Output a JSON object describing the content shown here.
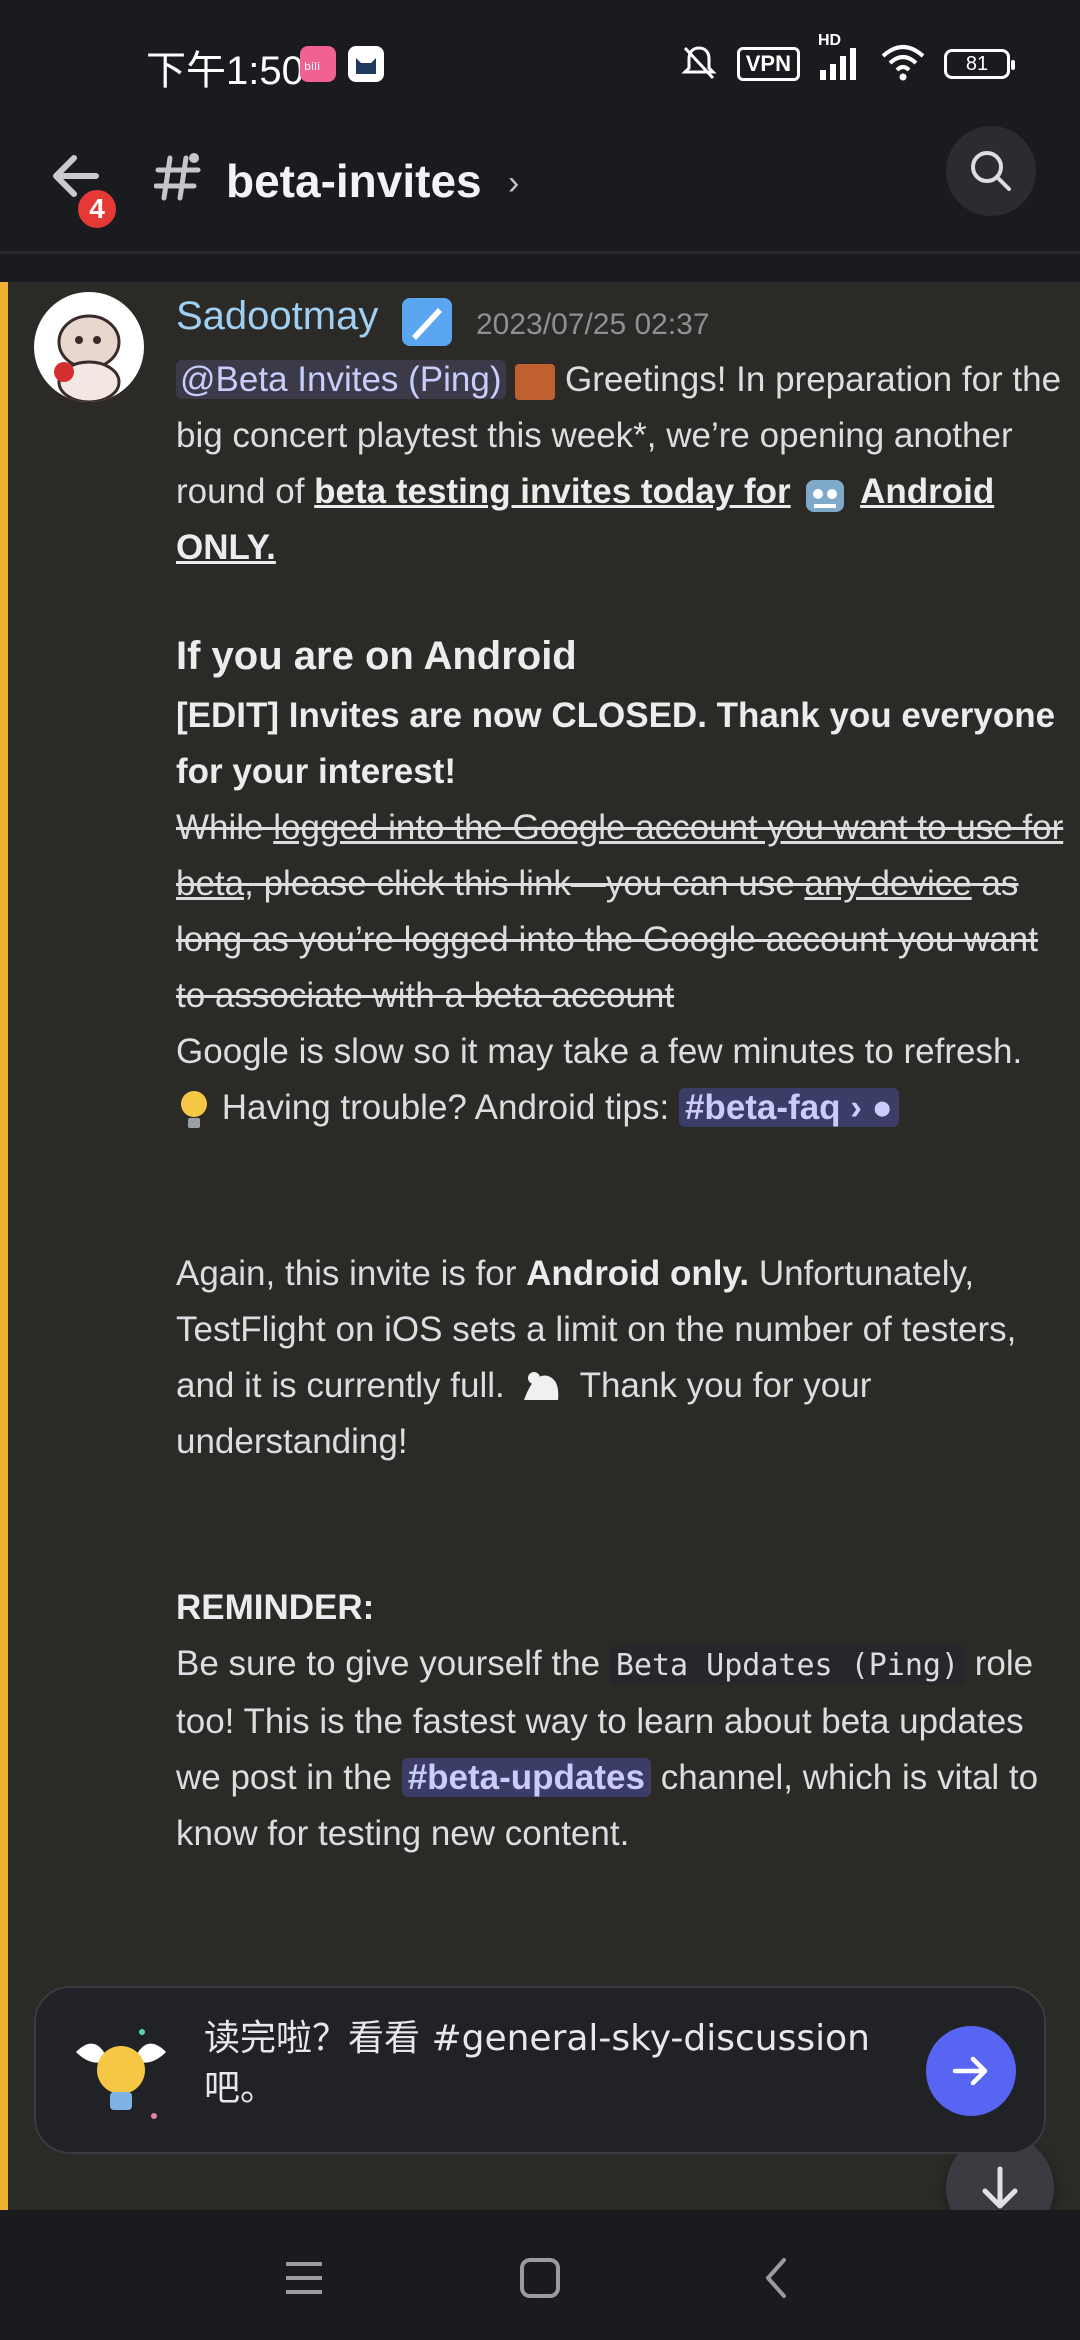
{
  "status_bar": {
    "time": "下午1:50",
    "vpn_label": "VPN",
    "hd_label": "HD",
    "battery": "81",
    "app_badges": [
      "bilibili-app-icon",
      "cat-app-icon"
    ],
    "icons": [
      "mute-icon",
      "vpn-icon",
      "signal-icon",
      "wifi-icon",
      "battery-icon"
    ]
  },
  "header": {
    "back_badge": "4",
    "channel_name": "beta-invites",
    "chevron": "›"
  },
  "message": {
    "author": "Sadootmay",
    "timestamp": "2023/07/25 02:37",
    "mention": "@Beta Invites (Ping)",
    "intro_text": "Greetings! In preparation for the big concert playtest this week*, we’re opening another round of ",
    "intro_link": "beta testing invites today for",
    "intro_link2": "Android ONLY.",
    "heading": "If you are on Android",
    "edit_notice": "[EDIT] Invites are now CLOSED. Thank you everyone for your interest!",
    "strike_1": "While ",
    "strike_link_1": "logged into the Google account you want to use for beta,",
    "strike_2": " please click this link—you can use ",
    "strike_link_2": "any device",
    "strike_3": " as long as you’re logged into the Google account you want to associate with a beta account",
    "slow_note": "Google is slow so it may take a few minutes to refresh.",
    "tips_text": "Having trouble? Android tips: ",
    "tips_channel": "#beta-faq",
    "again_1": "Again, this invite is for ",
    "again_bold": "Android only.",
    "again_2": " Unfortunately, TestFlight on iOS sets a limit on the number of testers, and it is currently full.",
    "again_3": " Thank you for your understanding!",
    "reminder_title": "REMINDER:",
    "reminder_1": "Be sure to give yourself the ",
    "reminder_code": "Beta Updates (Ping)",
    "reminder_2": " role too! This is the fastest way to learn about beta updates we post in the ",
    "reminder_channel": "#beta-updates",
    "reminder_3": " channel, which is vital to know for testing new content."
  },
  "read_card": {
    "text": "读完啦？看看 #general-sky-discussion 吧。"
  },
  "nav": [
    "menu-icon",
    "home-icon",
    "back-icon"
  ],
  "colors": {
    "accent_bar": "#f0b232",
    "username": "#9fd0f4",
    "blurple": "#5865f2",
    "badge_red": "#e53935"
  }
}
